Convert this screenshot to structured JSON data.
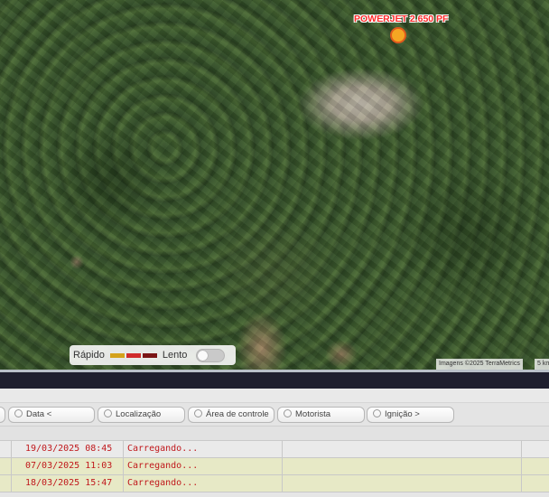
{
  "map": {
    "marker": {
      "label": "POWERJET 2.650 PF",
      "color": "#f5a623"
    },
    "legend": {
      "fast_label": "Rápido",
      "slow_label": "Lento",
      "colors": [
        "#d4a21a",
        "#d02b2b",
        "#7a1414"
      ],
      "toggle_on": false
    },
    "attribution": "Imagens ©2025 TerraMetrics",
    "scale": "5 km"
  },
  "filters": [
    {
      "label": "Data <",
      "name": "filter-data"
    },
    {
      "label": "Localização",
      "name": "filter-localizacao"
    },
    {
      "label": "Área de controle",
      "name": "filter-area"
    },
    {
      "label": "Motorista",
      "name": "filter-motorista"
    },
    {
      "label": "Ignição >",
      "name": "filter-ignicao"
    }
  ],
  "rows": [
    {
      "date": "19/03/2025 08:45",
      "location": "Carregando..."
    },
    {
      "date": "07/03/2025 11:03",
      "location": "Carregando..."
    },
    {
      "date": "18/03/2025 15:47",
      "location": "Carregando..."
    }
  ]
}
